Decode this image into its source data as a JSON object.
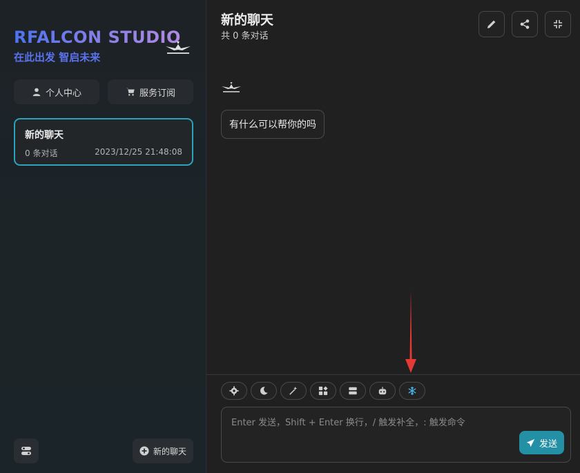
{
  "sidebar": {
    "brand_title": "RFALCON STUDIO",
    "brand_subtitle": "在此出发 智启未来",
    "profile_label": "个人中心",
    "subscribe_label": "服务订阅",
    "chats": [
      {
        "title": "新的聊天",
        "count": "0 条对话",
        "time": "2023/12/25 21:48:08"
      }
    ],
    "new_chat_label": "新的聊天"
  },
  "header": {
    "title": "新的聊天",
    "subtitle": "共 0 条对话"
  },
  "messages": [
    {
      "role": "bot",
      "text": "有什么可以帮你的吗"
    }
  ],
  "toolbar": {
    "tools": [
      "settings-icon",
      "moon-icon",
      "magic-wand-icon",
      "apps-icon",
      "list-icon",
      "robot-icon",
      "snowflake-icon"
    ]
  },
  "composer": {
    "placeholder": "Enter 发送，Shift + Enter 换行，/ 触发补全，: 触发命令",
    "send_label": "发送"
  },
  "colors": {
    "accent": "#2390a5",
    "card_border": "#2ba3b9",
    "brand_blue": "#5a72ee",
    "annotation_arrow": "#e53935",
    "snowflake": "#4db3f0"
  }
}
